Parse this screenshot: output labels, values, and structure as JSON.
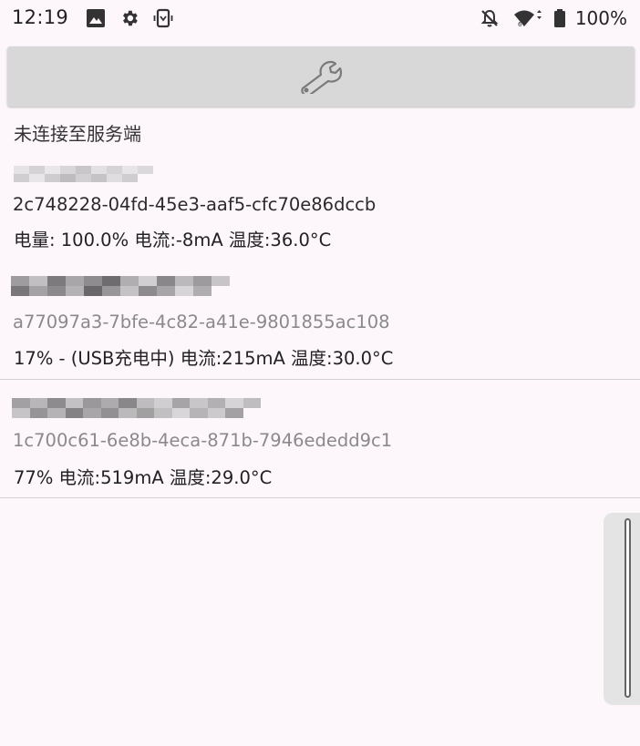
{
  "status_bar": {
    "time": "12:19",
    "left_icons": [
      "image-icon",
      "gear-icon",
      "phone-vibrate-icon"
    ],
    "right_icons": [
      "bell-off-icon",
      "wifi-icon",
      "battery-icon"
    ],
    "battery_percent": "100%"
  },
  "toolbar": {
    "icon": "wrench-icon"
  },
  "connection": {
    "status": "未连接至服务端"
  },
  "devices": [
    {
      "uuid": "2c748228-04fd-45e3-aaf5-cfc70e86dccb",
      "info": "电量: 100.0% 电流:-8mA 温度:36.0°C",
      "active": true
    },
    {
      "uuid": "a77097a3-7bfe-4c82-a41e-9801855ac108",
      "info": "17% - (USB充电中) 电流:215mA 温度:30.0°C",
      "active": false
    },
    {
      "uuid": "1c700c61-6e8b-4eca-871b-7946ededd9c1",
      "info": "77% 电流:519mA 温度:29.0°C",
      "active": false
    }
  ],
  "colors": {
    "background": "#fdf7fc",
    "toolbar": "#d8d8d8",
    "divider": "#d2d2d2",
    "secondary_text": "#8a8a8a"
  }
}
